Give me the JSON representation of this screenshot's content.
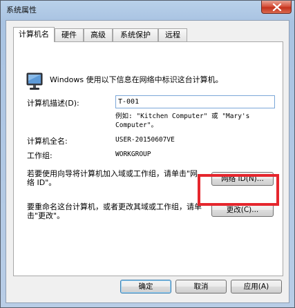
{
  "window": {
    "title": "系统属性",
    "close_label": "×"
  },
  "tabs": [
    {
      "label": "计算机名",
      "active": true
    },
    {
      "label": "硬件",
      "active": false
    },
    {
      "label": "高级",
      "active": false
    },
    {
      "label": "系统保护",
      "active": false
    },
    {
      "label": "远程",
      "active": false
    }
  ],
  "panel": {
    "intro_text": "Windows 使用以下信息在网络中标识这台计算机。",
    "description_label": "计算机描述(D):",
    "description_value": "T-001",
    "example_text": "例如: \"Kitchen Computer\" 或 \"Mary's Computer\"。",
    "full_name_label": "计算机全名:",
    "full_name_value": "USER-20150607VE",
    "workgroup_label": "工作组:",
    "workgroup_value": "WORKGROUP",
    "wizard_text": "若要使用向导将计算机加入域或工作组，请单击\"网络 ID\"。",
    "network_id_button": "网络 ID(N)...",
    "rename_text": "要重命名这台计算机，或者更改其域或工作组，请单击\"更改\"。",
    "change_button": "更改(C)..."
  },
  "footer": {
    "ok_button": "确定",
    "cancel_button": "取消",
    "apply_button": "应用(A)"
  },
  "colors": {
    "highlight": "#e5262d",
    "title_bar": "#b9d1ea",
    "close_button": "#c4321d"
  }
}
